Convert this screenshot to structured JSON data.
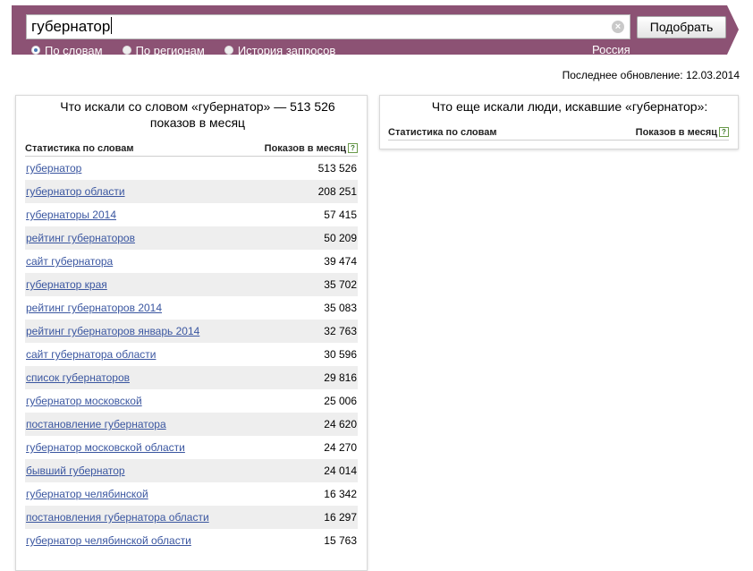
{
  "search": {
    "query": "губернатор",
    "submit_label": "Подобрать",
    "region": "Россия",
    "modes": [
      {
        "label": "По словам",
        "selected": true
      },
      {
        "label": "По регионам",
        "selected": false
      },
      {
        "label": "История запросов",
        "selected": false
      }
    ]
  },
  "last_update": "Последнее обновление:  12.03.2014",
  "left_panel": {
    "title": "Что искали со словом «губернатор» — 513 526 показов в месяц",
    "col_words": "Статистика по словам",
    "col_count": "Показов в месяц",
    "rows": [
      {
        "phrase": "губернатор",
        "count": "513 526"
      },
      {
        "phrase": "губернатор области",
        "count": "208 251"
      },
      {
        "phrase": "губернаторы 2014",
        "count": "57 415"
      },
      {
        "phrase": "рейтинг губернаторов",
        "count": "50 209"
      },
      {
        "phrase": "сайт губернатора",
        "count": "39 474"
      },
      {
        "phrase": "губернатор края",
        "count": "35 702"
      },
      {
        "phrase": "рейтинг губернаторов 2014",
        "count": "35 083"
      },
      {
        "phrase": "рейтинг губернаторов январь 2014",
        "count": "32 763"
      },
      {
        "phrase": "сайт губернатора области",
        "count": "30 596"
      },
      {
        "phrase": "список губернаторов",
        "count": "29 816"
      },
      {
        "phrase": "губернатор московской",
        "count": "25 006"
      },
      {
        "phrase": "постановление губернатора",
        "count": "24 620"
      },
      {
        "phrase": "губернатор московской области",
        "count": "24 270"
      },
      {
        "phrase": "бывший губернатор",
        "count": "24 014"
      },
      {
        "phrase": "губернатор челябинской",
        "count": "16 342"
      },
      {
        "phrase": "постановления губернатора области",
        "count": "16 297"
      },
      {
        "phrase": "губернатор челябинской области",
        "count": "15 763"
      }
    ]
  },
  "right_panel": {
    "title": "Что еще искали люди, искавшие «губернатор»:",
    "col_words": "Статистика по словам",
    "col_count": "Показов в месяц"
  },
  "icons": {
    "clear": "clear-icon",
    "help": "help-icon"
  },
  "colors": {
    "bar": "#8c5274",
    "link": "#3a56a0",
    "row_alt": "#eeeeee"
  }
}
